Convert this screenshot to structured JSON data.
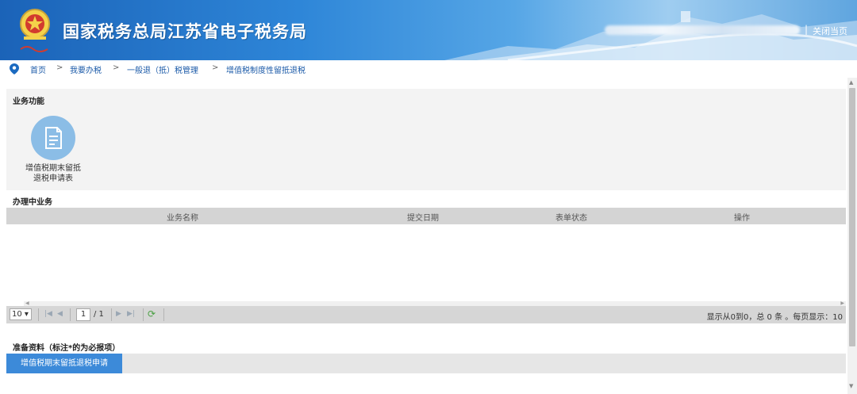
{
  "header": {
    "site_title": "国家税务总局江苏省电子税务局",
    "separator": "|",
    "close_label": "关闭当页"
  },
  "breadcrumb": {
    "items": [
      "首页",
      "我要办税",
      "一般退（抵）税管理",
      "增值税制度性留抵退税"
    ],
    "separator": ">"
  },
  "functions": {
    "title": "业务功能",
    "items": [
      {
        "label_line1": "增值税期末留抵",
        "label_line2": "退税申请表",
        "icon": "document-icon"
      }
    ]
  },
  "in_progress": {
    "title": "办理中业务",
    "columns": [
      "业务名称",
      "提交日期",
      "表单状态",
      "操作"
    ],
    "rows": []
  },
  "pager": {
    "page_size": "10 ▾",
    "page": "1",
    "of": "/ 1",
    "info": "显示从0到0，总 0 条 。每页显示：10"
  },
  "materials": {
    "title": "准备资料（标注*的为必报项）",
    "button_label": "增值税期末留抵退税申请"
  },
  "colors": {
    "header_blue": "#1b63b8",
    "accent_button": "#3c8ad9",
    "icon_circle": "#8bbde6"
  }
}
